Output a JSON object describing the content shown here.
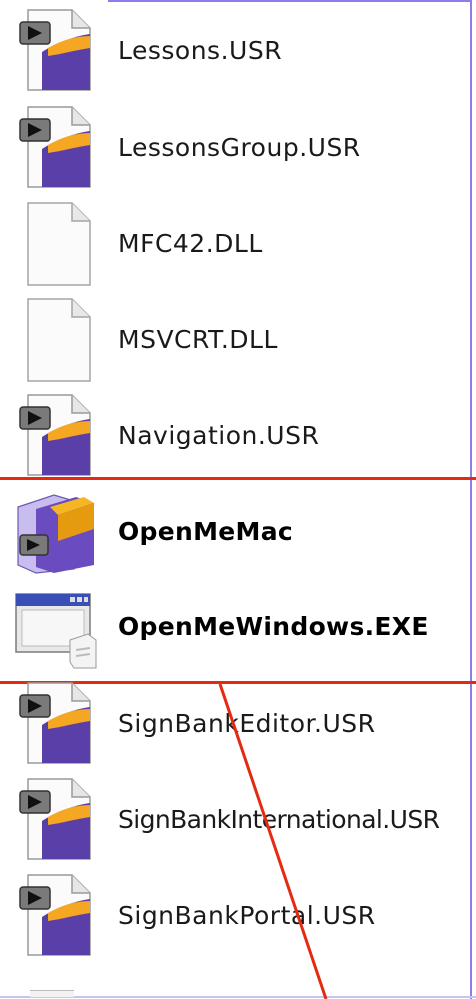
{
  "files": [
    {
      "name": "Lessons.USR",
      "icon": "shockwave-file-icon",
      "bold": false
    },
    {
      "name": "LessonsGroup.USR",
      "icon": "shockwave-file-icon",
      "bold": false
    },
    {
      "name": "MFC42.DLL",
      "icon": "blank-document-icon",
      "bold": false
    },
    {
      "name": "MSVCRT.DLL",
      "icon": "blank-document-icon",
      "bold": false
    },
    {
      "name": "Navigation.USR",
      "icon": "shockwave-file-icon",
      "bold": false
    },
    {
      "name": "OpenMeMac",
      "icon": "mac-application-icon",
      "bold": true
    },
    {
      "name": "OpenMeWindows.EXE",
      "icon": "windows-executable-icon",
      "bold": true
    },
    {
      "name": "SignBankEditor.USR",
      "icon": "shockwave-file-icon",
      "bold": false
    },
    {
      "name": "SignBankInternational.USR",
      "icon": "shockwave-file-icon",
      "bold": false
    },
    {
      "name": "SignBankPortal.USR",
      "icon": "shockwave-file-icon",
      "bold": false
    }
  ],
  "colors": {
    "highlight_line": "#e52a12",
    "frame": "#8c7ee8",
    "icon_purple": "#5b3fa8",
    "icon_orange": "#f5a623"
  }
}
